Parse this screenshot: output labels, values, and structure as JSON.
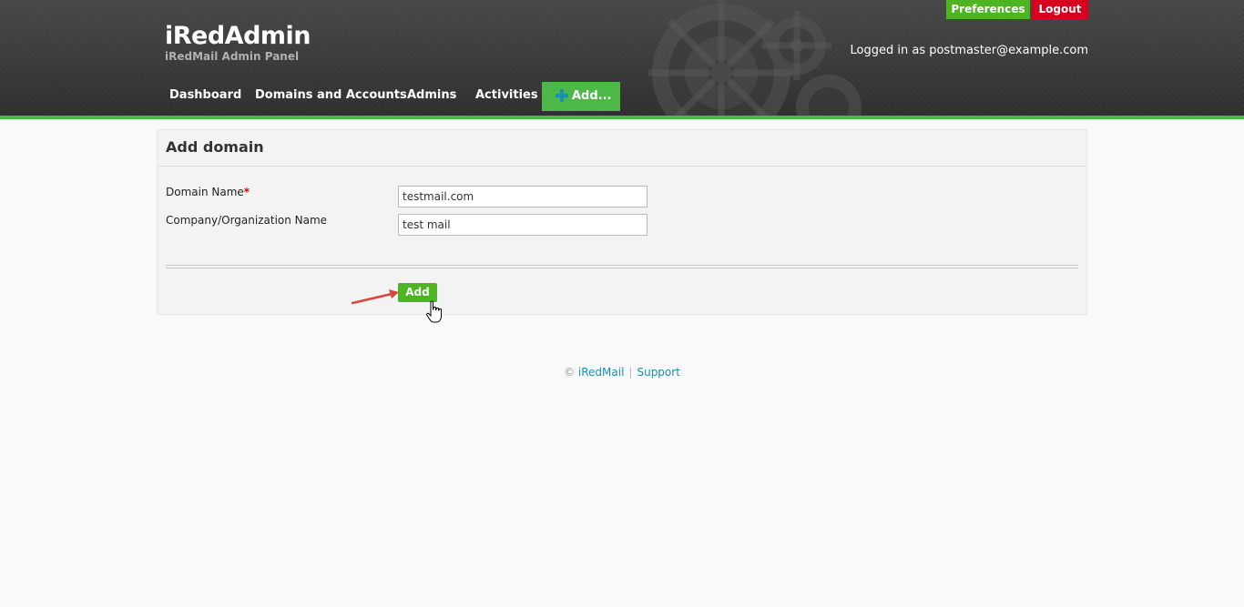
{
  "header": {
    "brand_title": "iRedAdmin",
    "brand_subtitle": "iRedMail Admin Panel",
    "preferences_label": "Preferences",
    "logout_label": "Logout",
    "logged_in_text": "Logged in as postmaster@example.com",
    "nav": {
      "dashboard": "Dashboard",
      "domains": "Domains and Accounts",
      "admins": "Admins",
      "activities": "Activities",
      "add": "Add..."
    },
    "accent_color": "#4cb848",
    "logout_color": "#d8001c"
  },
  "form": {
    "title": "Add domain",
    "domain_label": "Domain Name",
    "required_marker": "*",
    "domain_value": "testmail.com",
    "company_label": "Company/Organization Name",
    "company_value": "test mail",
    "submit_label": "Add"
  },
  "footer": {
    "copyright": "©",
    "brand_link": "iRedMail",
    "separator": "|",
    "support_link": "Support"
  },
  "icons": [
    "gears-decoration",
    "plus-icon",
    "annotation-arrow",
    "hand-cursor-icon"
  ]
}
